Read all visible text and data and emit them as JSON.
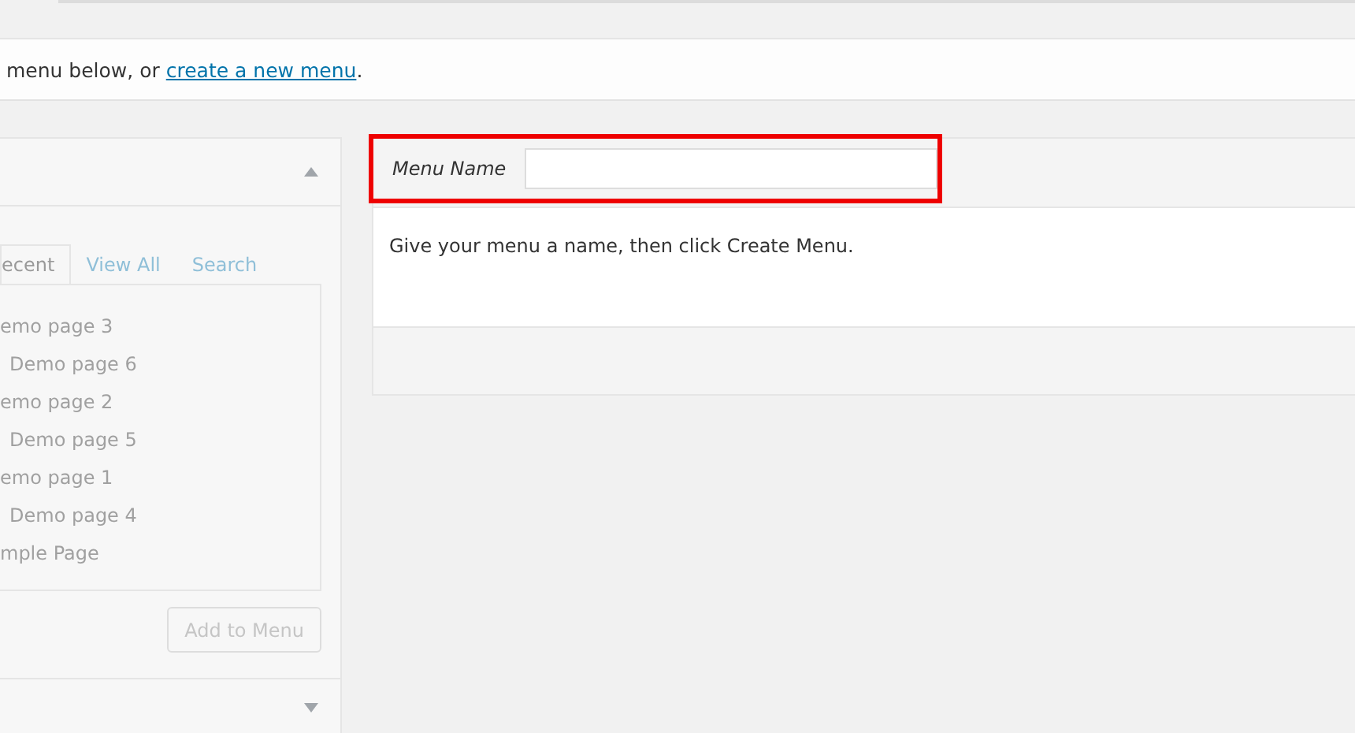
{
  "notice": {
    "text": "menu below, or ",
    "link": "create a new menu",
    "after": "."
  },
  "pages_panel": {
    "disabled": true,
    "tabs": [
      {
        "label": "ecent",
        "selected": true
      },
      {
        "label": "View All",
        "selected": false
      },
      {
        "label": "Search",
        "selected": false
      }
    ],
    "items": [
      {
        "label": "emo page 3",
        "children": [
          {
            "label": "Demo page 6"
          }
        ]
      },
      {
        "label": "emo page 2",
        "children": [
          {
            "label": "Demo page 5"
          }
        ]
      },
      {
        "label": "emo page 1",
        "children": [
          {
            "label": "Demo page 4"
          }
        ]
      },
      {
        "label": "mple Page"
      }
    ],
    "button": "Add to Menu"
  },
  "menu_editor": {
    "name_label": "Menu Name",
    "highlighted": true,
    "hint": "Give your menu a name, then click Create Menu."
  }
}
